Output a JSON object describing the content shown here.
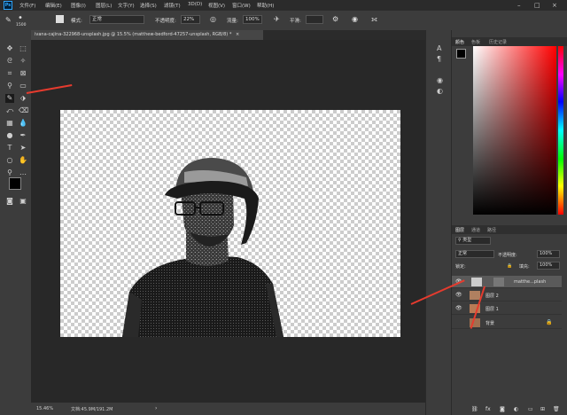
{
  "menu": {
    "items": [
      "文件(F)",
      "编辑(E)",
      "图像(I)",
      "图层(L)",
      "文字(Y)",
      "选择(S)",
      "滤镜(T)",
      "3D(D)",
      "视图(V)",
      "窗口(W)",
      "帮助(H)"
    ],
    "app_logo": "Ps"
  },
  "options": {
    "brush_size": "1500",
    "mode_label": "模式:",
    "mode_value": "正常",
    "opacity_label": "不透明度:",
    "opacity_value": "22%",
    "flow_label": "流量:",
    "flow_value": "100%",
    "smoothing_label": "平滑:"
  },
  "document": {
    "tab_title": "ivana-cajina-322968-unsplash.jpg @ 15.5% (matthew-bedford-47257-unsplash, RGB/8) *",
    "tab_close": "×"
  },
  "status": {
    "zoom": "15.46%",
    "doc_size": "文档:45.9M/191.2M"
  },
  "color_panel": {
    "tabs": [
      "颜色",
      "色板",
      "历史记录"
    ],
    "hue_color": "#ff0000"
  },
  "layers_panel": {
    "tabs": [
      "图层",
      "通道",
      "路径"
    ],
    "filter_label": "类型",
    "blend_mode": "正常",
    "opacity_label": "不透明度:",
    "opacity_value": "100%",
    "lock_label": "锁定:",
    "fill_label": "填充:",
    "fill_value": "100%",
    "layers": [
      {
        "name": "matthe...plash",
        "visible": true,
        "selected": true
      },
      {
        "name": "图层 2",
        "visible": true,
        "selected": false
      },
      {
        "name": "图层 1",
        "visible": true,
        "selected": false
      },
      {
        "name": "背景",
        "visible": false,
        "selected": false
      }
    ],
    "footer_icons": [
      "link-icon",
      "fx-icon",
      "mask-icon",
      "adjustment-icon",
      "group-icon",
      "new-layer-icon",
      "delete-icon"
    ]
  },
  "colors": {
    "accent_arrow": "#e63b2e",
    "ps_blue": "#31a8ff"
  }
}
